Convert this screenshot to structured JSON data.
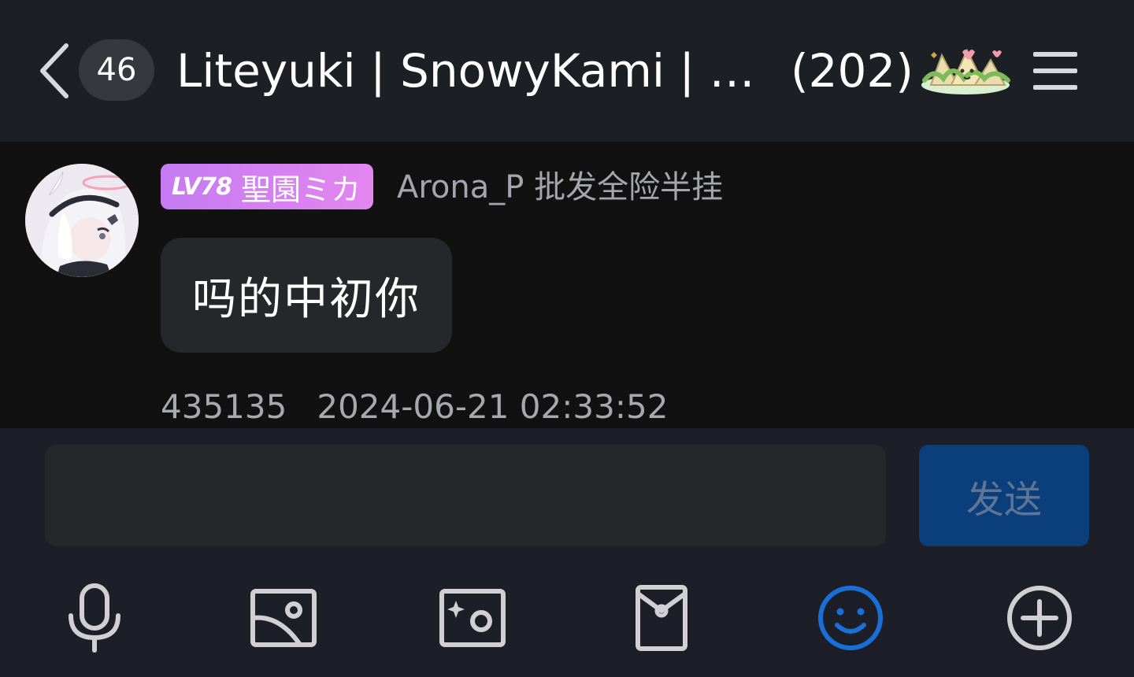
{
  "header": {
    "unread_count": "46",
    "group_title": "Liteyuki | SnowyKami | B…",
    "member_count": "(202)",
    "icons": [
      "chevron-left-icon",
      "group-decoration-icon",
      "menu-icon"
    ]
  },
  "message": {
    "badge_level": "LV78",
    "badge_title": "聖園ミカ",
    "sender_name": "Arona_P 批发全险半挂",
    "text": "吗的中初你",
    "sender_id": "435135",
    "timestamp": "2024-06-21 02:33:52"
  },
  "composer": {
    "input_value": "",
    "send_label": "发送",
    "tools": [
      "microphone-icon",
      "image-icon",
      "photo-camera-icon",
      "red-packet-icon",
      "emoji-icon",
      "add-icon"
    ],
    "active_tool_color": "#1a6fd6",
    "tool_color": "#d0d0d4"
  },
  "colors": {
    "header_bg": "#1c1f24",
    "chat_bg": "#111112",
    "bubble_bg": "#25272b",
    "composer_bg": "#1c1e28",
    "send_bg": "#0a3f7c",
    "badge_gradient_start": "#c57bf2",
    "badge_gradient_end": "#e386f0"
  }
}
